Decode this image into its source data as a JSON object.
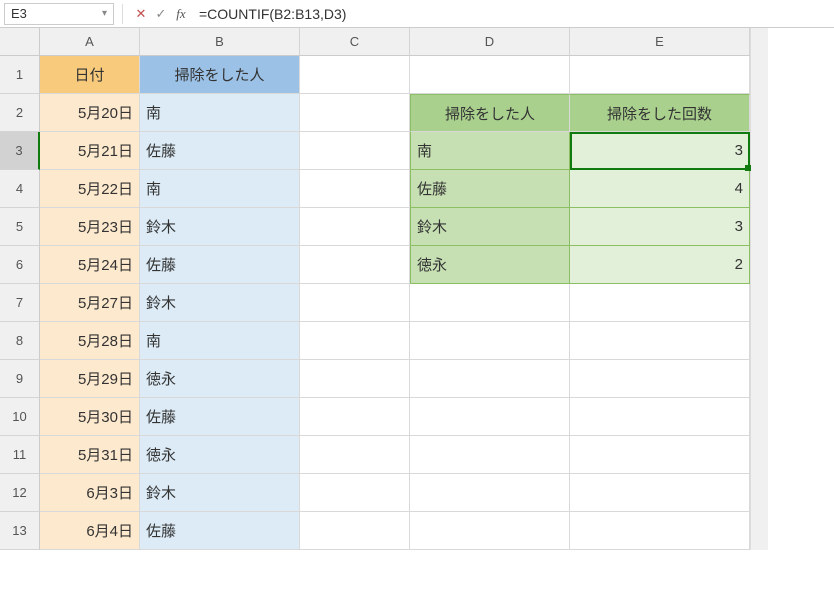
{
  "namebox": {
    "value": "E3"
  },
  "formula": "=COUNTIF(B2:B13,D3)",
  "cols": {
    "A": "A",
    "B": "B",
    "C": "C",
    "D": "D",
    "E": "E"
  },
  "rows": [
    "1",
    "2",
    "3",
    "4",
    "5",
    "6",
    "7",
    "8",
    "9",
    "10",
    "11",
    "12",
    "13"
  ],
  "headers": {
    "A1": "日付",
    "B1": "掃除をした人"
  },
  "data": {
    "A2": "5月20日",
    "B2": "南",
    "A3": "5月21日",
    "B3": "佐藤",
    "A4": "5月22日",
    "B4": "南",
    "A5": "5月23日",
    "B5": "鈴木",
    "A6": "5月24日",
    "B6": "佐藤",
    "A7": "5月27日",
    "B7": "鈴木",
    "A8": "5月28日",
    "B8": "南",
    "A9": "5月29日",
    "B9": "徳永",
    "A10": "5月30日",
    "B10": "佐藤",
    "A11": "5月31日",
    "B11": "徳永",
    "A12": "6月3日",
    "B12": "鈴木",
    "A13": "6月4日",
    "B13": "佐藤"
  },
  "summary": {
    "D2": "掃除をした人",
    "E2": "掃除をした回数",
    "D3": "南",
    "E3": "3",
    "D4": "佐藤",
    "E4": "4",
    "D5": "鈴木",
    "E5": "3",
    "D6": "徳永",
    "E6": "2"
  },
  "selection": {
    "cell": "E3",
    "row": 3,
    "col": "E"
  }
}
